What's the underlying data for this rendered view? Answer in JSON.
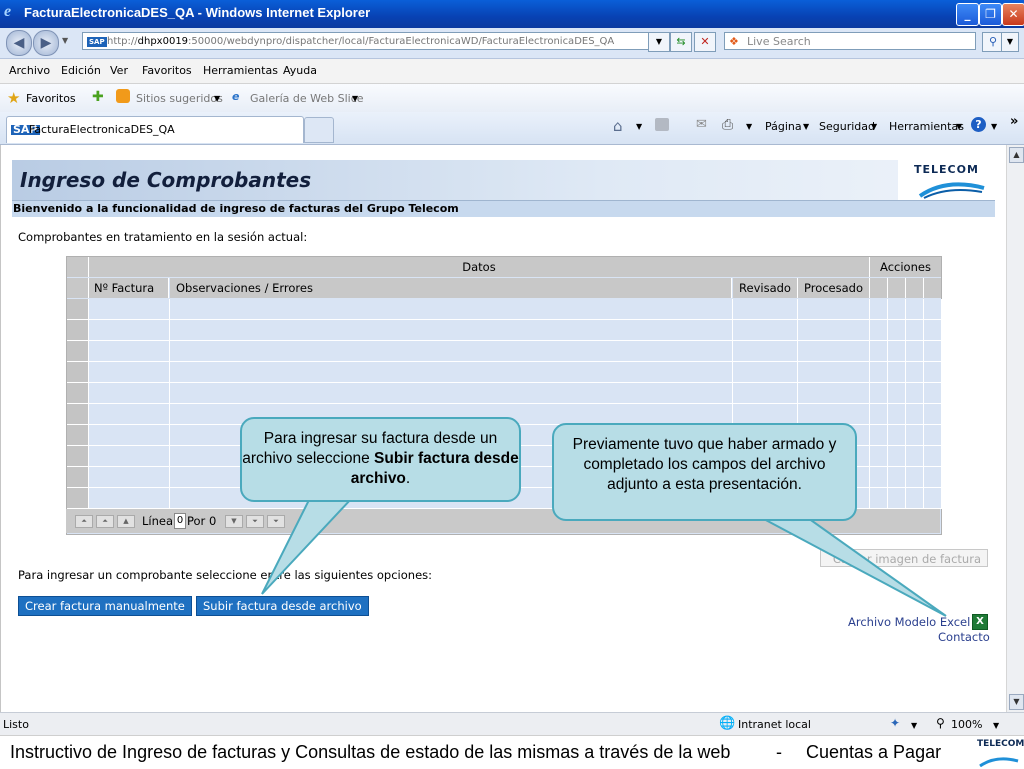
{
  "window": {
    "title": "FacturaElectronicaDES_QA - Windows Internet Explorer"
  },
  "address": {
    "url_prefix": "http://",
    "url_host": "dhpx0019",
    "url_rest": ":50000/webdynpro/dispatcher/local/FacturaElectronicaWD/FacturaElectronicaDES_QA",
    "search_placeholder": "Live Search"
  },
  "menu": {
    "items": [
      "Archivo",
      "Edición",
      "Ver",
      "Favoritos",
      "Herramientas",
      "Ayuda"
    ]
  },
  "favorites_bar": {
    "favorites": "Favoritos",
    "suggested": "Sitios sugeridos",
    "gallery": "Galería de Web Slice"
  },
  "tab": {
    "label": "FacturaElectronicaDES_QA"
  },
  "command_bar": {
    "page": "Página",
    "security": "Seguridad",
    "tools": "Herramientas"
  },
  "page": {
    "title": "Ingreso de Comprobantes",
    "brand": "TELECOM",
    "welcome": "Bienvenido a la funcionalidad de ingreso de facturas del Grupo Telecom",
    "intro": "Comprobantes en tratamiento en la sesión actual:"
  },
  "table": {
    "group_datos": "Datos",
    "group_acciones": "Acciones",
    "columns": [
      "Nº Factura",
      "Observaciones / Errores",
      "Revisado",
      "Procesado"
    ],
    "row_label": "Línea",
    "row_value": "0",
    "row_of": "Por 0"
  },
  "actions": {
    "prompt": "Para ingresar un comprobante seleccione entre las siguientes opciones:",
    "create_manual": "Crear factura manualmente",
    "upload_file": "Subir factura desde archivo",
    "upload_image": "Cargar imagen de factura",
    "model_excel": "Archivo Modelo Excel",
    "contact": "Contacto"
  },
  "callouts": {
    "left_text_1": "Para ingresar su factura desde un archivo seleccione ",
    "left_bold": "Subir factura desde archivo",
    "left_text_2": ".",
    "right_text": "Previamente tuvo que haber armado y completado los campos del archivo adjunto a esta presentación."
  },
  "status": {
    "left": "Listo",
    "zone": "Intranet local",
    "zoom": "100%"
  },
  "footer": {
    "left": "Instructivo de Ingreso de facturas y Consultas de estado de las mismas a través de la web",
    "sep": "-",
    "right": "Cuentas a Pagar",
    "brand": "TELECOM"
  },
  "colors": {
    "sap_button": "#1e70c1",
    "callout_fill": "#b7dde6",
    "callout_border": "#4aa9bd"
  }
}
